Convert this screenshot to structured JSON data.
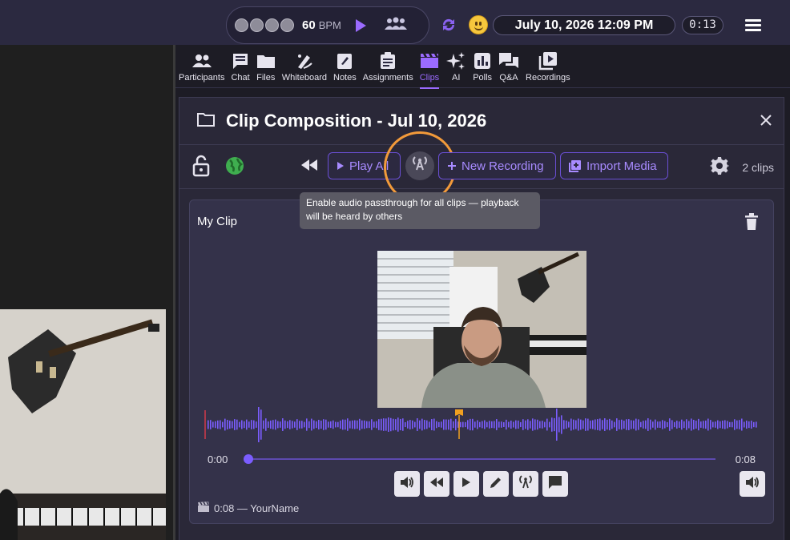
{
  "topbar": {
    "bpm_value": "60",
    "bpm_label": "BPM",
    "datetime": "July 10, 2026 12:09 PM",
    "timer": "0:13"
  },
  "tabs": [
    {
      "label": "Participants",
      "icon": "participants-icon"
    },
    {
      "label": "Chat",
      "icon": "chat-icon"
    },
    {
      "label": "Files",
      "icon": "folder-icon"
    },
    {
      "label": "Whiteboard",
      "icon": "whiteboard-icon"
    },
    {
      "label": "Notes",
      "icon": "notes-icon"
    },
    {
      "label": "Assignments",
      "icon": "assignments-icon"
    },
    {
      "label": "Clips",
      "icon": "clips-icon",
      "active": true
    },
    {
      "label": "AI",
      "icon": "ai-sparkle-icon"
    },
    {
      "label": "Polls",
      "icon": "polls-icon"
    },
    {
      "label": "Q&A",
      "icon": "qa-icon"
    },
    {
      "label": "Recordings",
      "icon": "recordings-icon"
    }
  ],
  "panel": {
    "title": "Clip Composition - Jul 10, 2026",
    "play_all": "Play All",
    "new_recording": "New Recording",
    "import_media": "Import Media",
    "clips_count": "2 clips",
    "tooltip": "Enable audio passthrough for all clips — playback will be heard by others"
  },
  "clip": {
    "name": "My Clip",
    "time_start": "0:00",
    "time_end": "0:08",
    "author": "0:08 — YourName"
  },
  "colors": {
    "accent": "#9b6bff",
    "highlight_ring": "#f29a3a",
    "marker": "#f0a020"
  }
}
